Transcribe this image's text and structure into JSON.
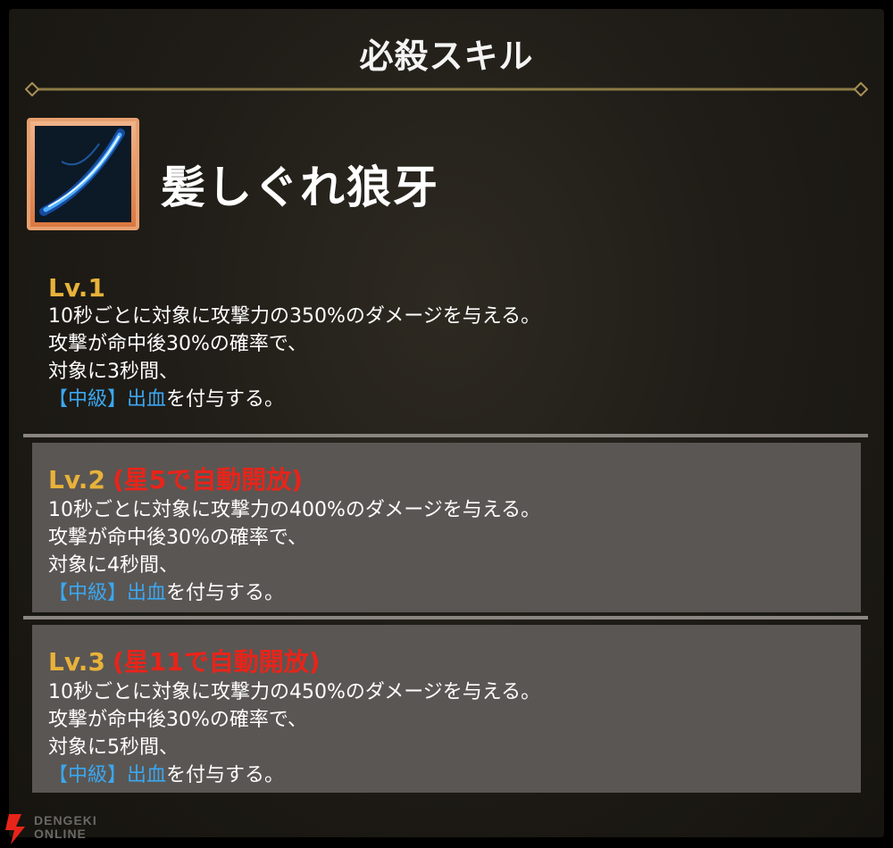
{
  "panel": {
    "title": "必殺スキル"
  },
  "skill": {
    "name": "髪しぐれ狼牙",
    "icon": "blue-slash-icon"
  },
  "levels": [
    {
      "level_label": "Lv.1",
      "unlock_note": "",
      "line1": "10秒ごとに対象に攻撃力の350%のダメージを与える。",
      "line2": "攻撃が命中後30%の確率で、",
      "line3": "対象に3秒間、",
      "status_tier": "【中級】",
      "status_name": "出血",
      "line4_suffix": "を付与する。"
    },
    {
      "level_label": "Lv.2",
      "unlock_note": "(星5で自動開放)",
      "line1": "10秒ごとに対象に攻撃力の400%のダメージを与える。",
      "line2": "攻撃が命中後30%の確率で、",
      "line3": "対象に4秒間、",
      "status_tier": "【中級】",
      "status_name": "出血",
      "line4_suffix": "を付与する。"
    },
    {
      "level_label": "Lv.3",
      "unlock_note": "(星11で自動開放)",
      "line1": "10秒ごとに対象に攻撃力の450%のダメージを与える。",
      "line2": "攻撃が命中後30%の確率で、",
      "line3": "対象に5秒間、",
      "status_tier": "【中級】",
      "status_name": "出血",
      "line4_suffix": "を付与する。"
    }
  ],
  "watermark": {
    "line1": "DENGEKI",
    "line2": "ONLINE"
  },
  "colors": {
    "level_label": "#e8b23a",
    "unlock_note": "#e8241a",
    "status_effect": "#3aa7f0",
    "locked_bg": "#5a5653"
  }
}
